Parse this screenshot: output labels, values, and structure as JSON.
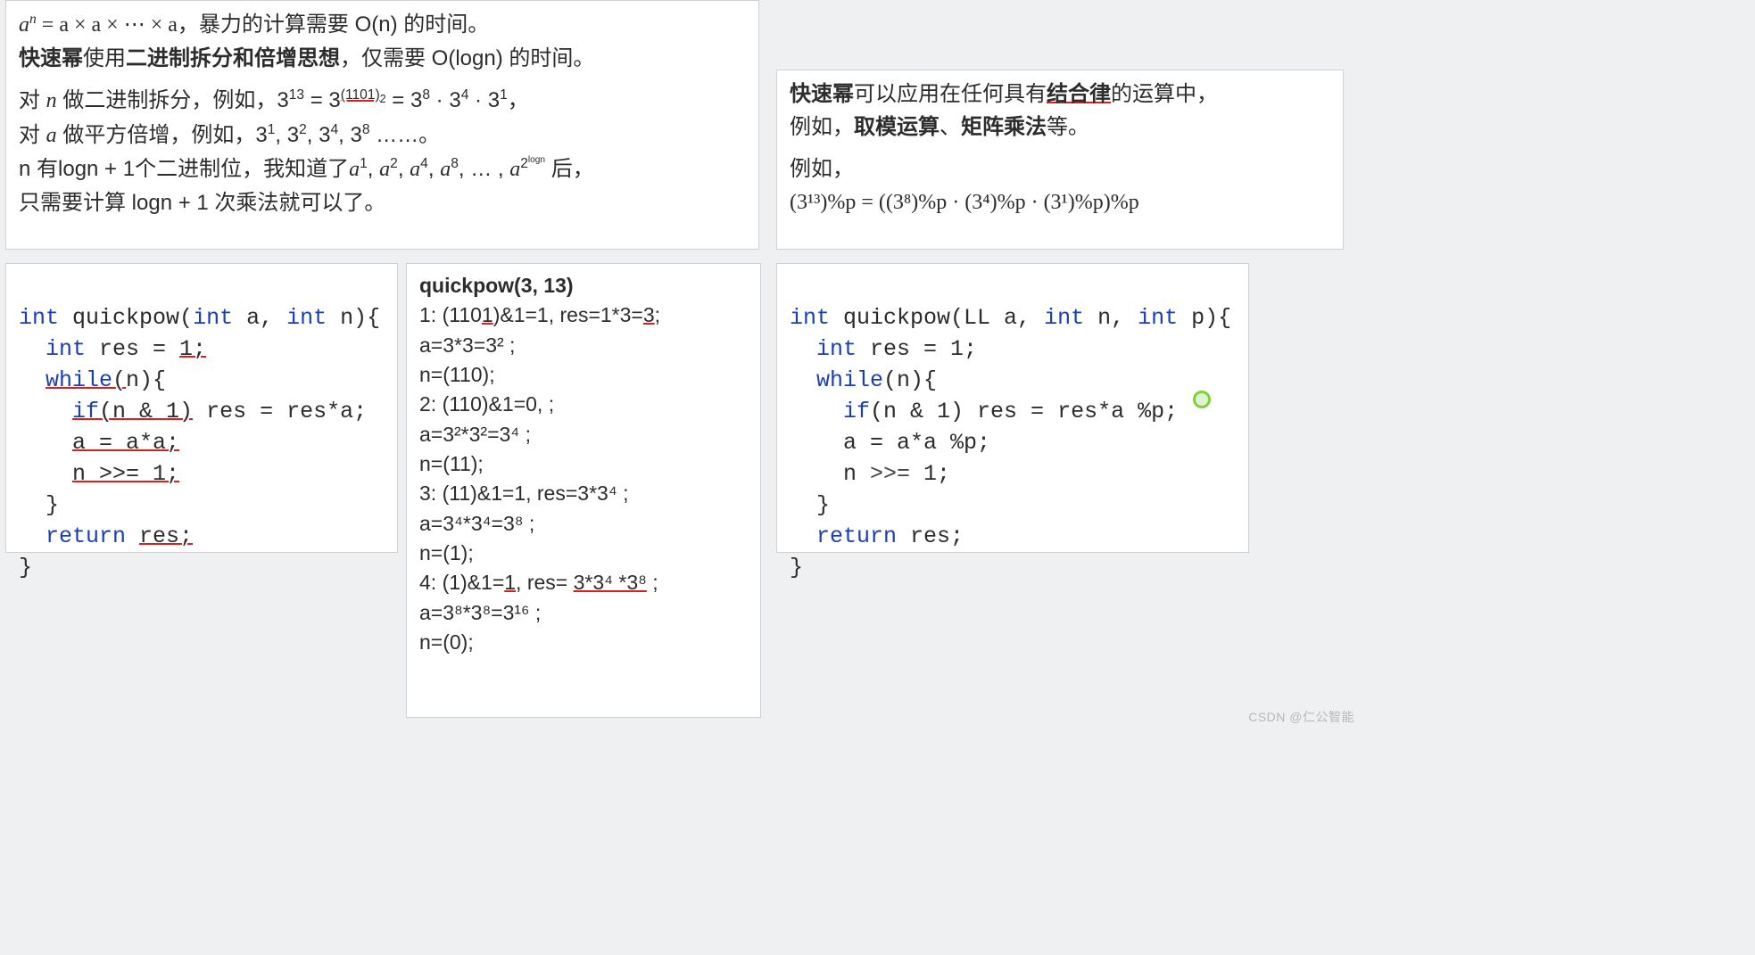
{
  "top_left": {
    "l1_lhs": "a",
    "l1_sup": "n",
    "l1_eq": " = a × a × ⋯ × a，",
    "l1_tail": "暴力的计算需要 O(n) 的时间。",
    "l2_b1": "快速幂",
    "l2_mid": "使用",
    "l2_b2": "二进制拆分和倍增思想",
    "l2_tail": "，仅需要 O(logn) 的时间。",
    "l3a": "对 ",
    "l3_n": "n",
    "l3b": " 做二进制拆分，例如，3",
    "l3_exp1": "13",
    "l3c": " = 3",
    "l3_exp2": "(1101)",
    "l3_exp2sub": "2",
    "l3d": " = 3",
    "l3e8": "8",
    "l3dot1": " · 3",
    "l3e4": "4",
    "l3dot2": " · 3",
    "l3e1": "1",
    "l3end": "，",
    "l4a": "对 ",
    "l4_a": "a",
    "l4b": " 做平方倍增，例如，3",
    "l4_1": "1",
    "l4c": ", 3",
    "l4_2": "2",
    "l4d": ", 3",
    "l4_4": "4",
    "l4e": ", 3",
    "l4_8": "8",
    "l4end": " ……。",
    "l5a": " n 有logn + 1个二进制位，我知道了",
    "l5_a1": "a",
    "l5_e1": "1",
    "l5_c1": ", ",
    "l5_a2": "a",
    "l5_e2": "2",
    "l5_c2": ", ",
    "l5_a4": "a",
    "l5_e4": "4",
    "l5_c3": ", ",
    "l5_a8": "a",
    "l5_e8": "8",
    "l5_c4": ", … , ",
    "l5_alogn": "a",
    "l5_elogn_base": "2",
    "l5_elogn_sup": "logn",
    "l5_end": " 后，",
    "l6": "只需要计算 logn + 1 次乘法就可以了。"
  },
  "top_right": {
    "l1_b1": "快速幂",
    "l1_mid": "可以应用在任何具有",
    "l1_b2": "结合律",
    "l1_tail": "的运算中，",
    "l2_a": "例如，",
    "l2_b1": "取模运算",
    "l2_sep": "、",
    "l2_b2": "矩阵乘法",
    "l2_tail": "等。",
    "l3": "例如，",
    "l4": " (3¹³)%p = ((3⁸)%p · (3⁴)%p · (3¹)%p)%p"
  },
  "code1": {
    "title": "",
    "lines": [
      {
        "kw": "int ",
        "fn": "quickpow",
        "rest": "(",
        "kw2": "int ",
        "a": "a, ",
        "kw3": "int ",
        "n": "n){"
      },
      {
        "indent": "  ",
        "kw": "int ",
        "rest": "res = ",
        "ul": "1;"
      },
      {
        "indent": "  ",
        "ul": "while(",
        "kw": "",
        "paren": "n){"
      },
      {
        "indent": "    ",
        "ul": "if(n & 1)",
        "rest": " res = res*a;"
      },
      {
        "indent": "    ",
        "ul": "a = a*a;"
      },
      {
        "indent": "    ",
        "ul": "n >>= 1;"
      },
      {
        "indent": "  ",
        "rest": "}"
      },
      {
        "indent": "  ",
        "kw": "return ",
        "ul": "res;"
      },
      {
        "rest": "}"
      }
    ]
  },
  "trace": {
    "heading": "quickpow(3, 13)",
    "l1": "1: (1101)&1=1, res=1*3=3;",
    "l1b": "   a=3*3=3² ;",
    "l1c": "   n=(110);",
    "l2": "2: (110)&1=0, ;",
    "l2b": "   a=3²*3²=3⁴ ;",
    "l2c": "   n=(11);",
    "l3": "3: (11)&1=1, res=3*3⁴ ;",
    "l3b": "   a=3⁴*3⁴=3⁸ ;",
    "l3c": "   n=(1);",
    "l4": "4: (1)&1=1, res= 3*3⁴ *3⁸ ;",
    "l4b": "   a=3⁸*3⁸=3¹⁶ ;",
    "l4c": "   n=(0);"
  },
  "code2": {
    "l1_a": "int ",
    "l1_b": "quickpow(LL a, ",
    "l1_c": "int ",
    "l1_d": "n, ",
    "l1_e": "int ",
    "l1_f": "p){",
    "l2_a": "  ",
    "l2_b": "int ",
    "l2_c": "res = 1;",
    "l3_a": "  ",
    "l3_b": "while",
    "l3_c": "(n){",
    "l4_a": "    ",
    "l4_b": "if",
    "l4_c": "(n & 1) res = res*a %p;",
    "l5": "    a = a*a %p;",
    "l6_a": "    n ",
    "l6_b": ">>=",
    "l6_c": " 1;",
    "l7": "  }",
    "l8_a": "  ",
    "l8_b": "return ",
    "l8_c": "res;",
    "l9": "}"
  },
  "watermark": "CSDN @仁公智能"
}
